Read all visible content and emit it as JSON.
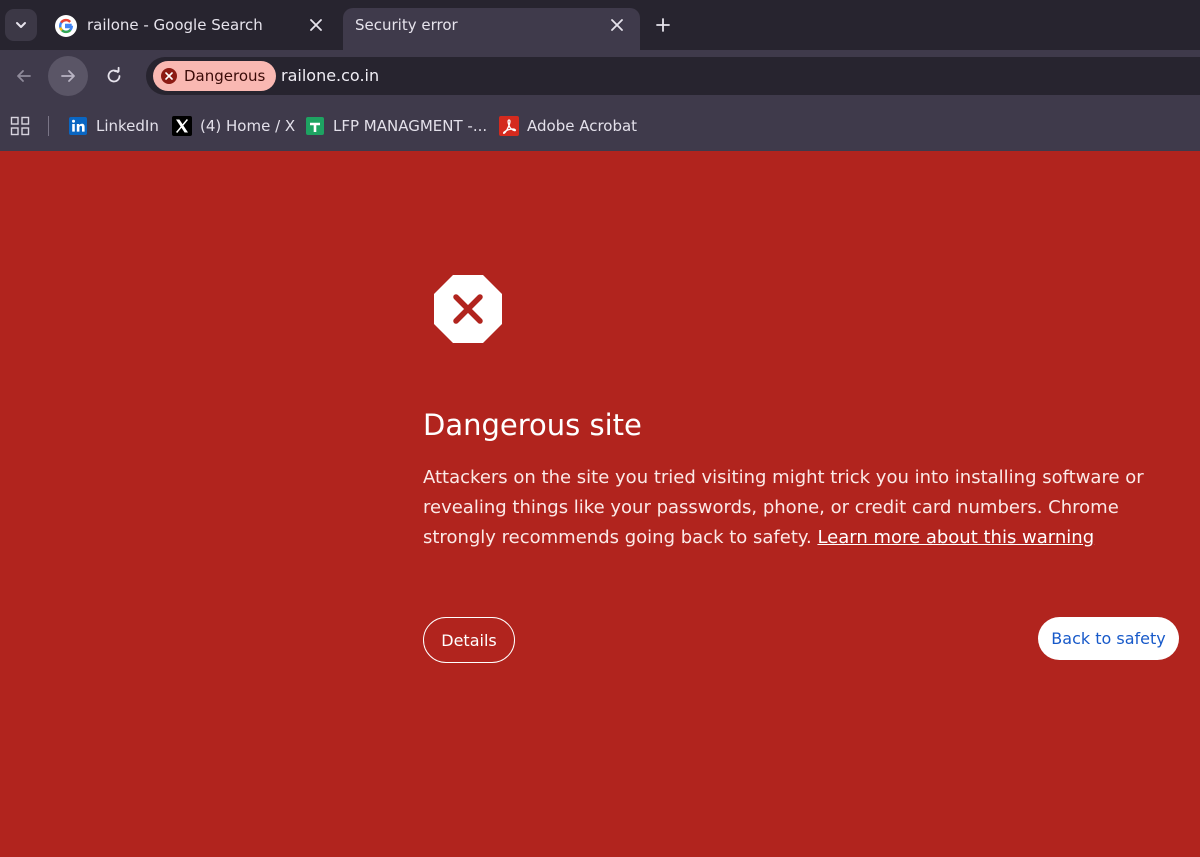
{
  "tabs": [
    {
      "title": "railone - Google Search",
      "favicon": "google-g-icon",
      "active": false
    },
    {
      "title": "Security error",
      "favicon": "",
      "active": true
    }
  ],
  "toolbar": {
    "security_chip": "Dangerous",
    "url": "railone.co.in"
  },
  "bookmarks": [
    {
      "label": "LinkedIn",
      "icon": "linkedin-icon"
    },
    {
      "label": "(4) Home / X",
      "icon": "x-icon"
    },
    {
      "label": "LFP MANAGMENT -...",
      "icon": "google-sheets-icon"
    },
    {
      "label": "Adobe Acrobat",
      "icon": "adobe-acrobat-icon"
    }
  ],
  "interstitial": {
    "heading": "Dangerous site",
    "body": "Attackers on the site you tried visiting might trick you into installing software or revealing things like your passwords, phone, or credit card numbers. Chrome strongly recommends going back to safety.",
    "learn_more": "Learn more about this warning",
    "details_button": "Details",
    "back_button": "Back to safety"
  },
  "colors": {
    "danger_background": "#b1241e",
    "chrome_dark": "#27242f",
    "chrome_toolbar": "#3f3a4b",
    "chip_background": "#f9b8b2",
    "link_blue": "#1759c9"
  }
}
